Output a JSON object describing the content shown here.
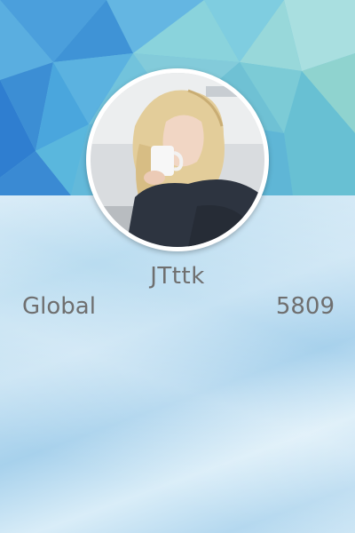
{
  "profile": {
    "username": "JTttk",
    "rank_label": "Global",
    "rank_value": "5809"
  },
  "colors": {
    "text": "#6f6f6f",
    "header_primary": "#3a8fd4",
    "header_teal": "#8fd3cf",
    "avatar_border": "#ffffff"
  },
  "icons": {
    "avatar": "user-photo-avatar"
  }
}
